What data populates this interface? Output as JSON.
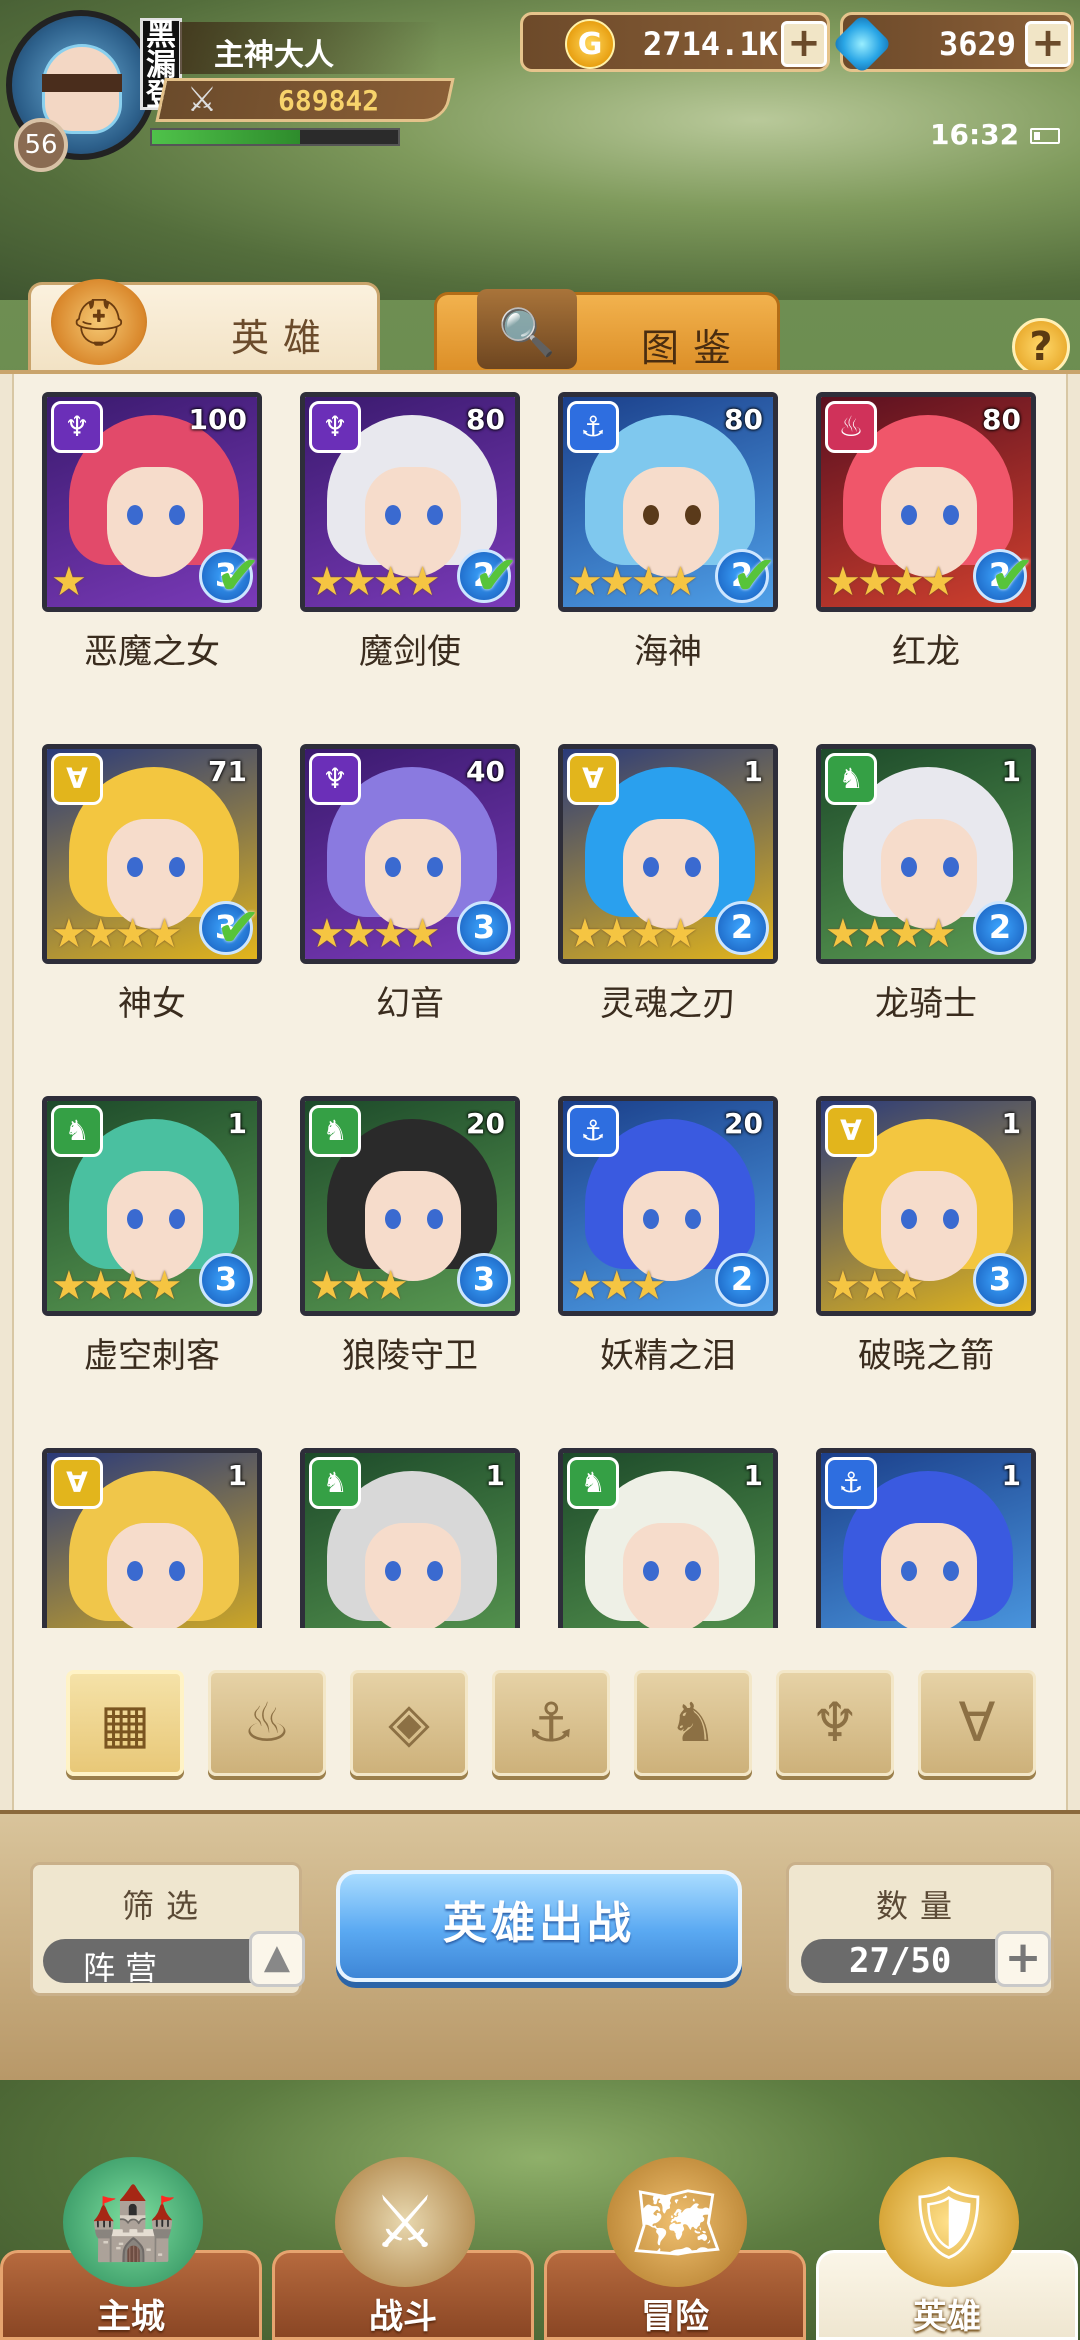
{
  "player": {
    "name": "主神大人",
    "guild_tag": "黑漏登",
    "level": "56",
    "power": "689842",
    "exp_fraction": 0.6
  },
  "currencies": {
    "gold": "2714.1K",
    "gems": "3629"
  },
  "status": {
    "time": "16:32"
  },
  "tabs": [
    {
      "label": "英雄",
      "active": true
    },
    {
      "label": "图鉴",
      "active": false
    }
  ],
  "heroes": [
    {
      "name": "恶魔之女",
      "level": "100",
      "faction": "dark",
      "stars": "★",
      "grade": "3",
      "deployed": true
    },
    {
      "name": "魔剑使",
      "level": "80",
      "faction": "dark",
      "stars": "★★★★",
      "grade": "2",
      "deployed": true
    },
    {
      "name": "海神",
      "level": "80",
      "faction": "water",
      "stars": "★★★★",
      "grade": "2",
      "deployed": true
    },
    {
      "name": "红龙",
      "level": "80",
      "faction": "fire",
      "stars": "★★★★",
      "grade": "2",
      "deployed": true
    },
    {
      "name": "神女",
      "level": "71",
      "faction": "light",
      "stars": "★★★★",
      "grade": "3",
      "deployed": true
    },
    {
      "name": "幻音",
      "level": "40",
      "faction": "dark",
      "stars": "★★★★",
      "grade": "3",
      "deployed": false
    },
    {
      "name": "灵魂之刃",
      "level": "1",
      "faction": "light",
      "stars": "★★★★",
      "grade": "2",
      "deployed": false
    },
    {
      "name": "龙骑士",
      "level": "1",
      "faction": "nature",
      "stars": "★★★★",
      "grade": "2",
      "deployed": false
    },
    {
      "name": "虚空刺客",
      "level": "1",
      "faction": "nature",
      "stars": "★★★★",
      "grade": "3",
      "deployed": false
    },
    {
      "name": "狼陵守卫",
      "level": "20",
      "faction": "nature",
      "stars": "★★★",
      "grade": "3",
      "deployed": false
    },
    {
      "name": "妖精之泪",
      "level": "20",
      "faction": "water",
      "stars": "★★★",
      "grade": "2",
      "deployed": false
    },
    {
      "name": "破晓之箭",
      "level": "1",
      "faction": "light",
      "stars": "★★★",
      "grade": "3",
      "deployed": false
    },
    {
      "name": "",
      "level": "1",
      "faction": "light",
      "stars": "",
      "grade": "",
      "deployed": false
    },
    {
      "name": "",
      "level": "1",
      "faction": "nature",
      "stars": "",
      "grade": "",
      "deployed": false
    },
    {
      "name": "",
      "level": "1",
      "faction": "nature",
      "stars": "",
      "grade": "",
      "deployed": false
    },
    {
      "name": "",
      "level": "1",
      "faction": "water",
      "stars": "",
      "grade": "",
      "deployed": false
    }
  ],
  "faction_filters": [
    {
      "icon": "all-grid-icon",
      "active": true
    },
    {
      "icon": "fire-faction-icon",
      "active": false
    },
    {
      "icon": "ice-faction-icon",
      "active": false
    },
    {
      "icon": "water-anchor-icon",
      "active": false
    },
    {
      "icon": "nature-beast-icon",
      "active": false
    },
    {
      "icon": "dark-horns-icon",
      "active": false
    },
    {
      "icon": "light-wings-icon",
      "active": false
    }
  ],
  "filter": {
    "title": "筛选",
    "value": "阵营"
  },
  "deploy_button": "英雄出战",
  "count": {
    "title": "数量",
    "value": "27/50"
  },
  "nav": [
    {
      "label": "主城",
      "active": false
    },
    {
      "label": "战斗",
      "active": false
    },
    {
      "label": "冒险",
      "active": false
    },
    {
      "label": "英雄",
      "active": true
    }
  ],
  "colors": {
    "dark": "#6b2fb8",
    "water": "#2e6ee0",
    "fire": "#d0325a",
    "light": "#e2b51c",
    "nature": "#35a045"
  }
}
